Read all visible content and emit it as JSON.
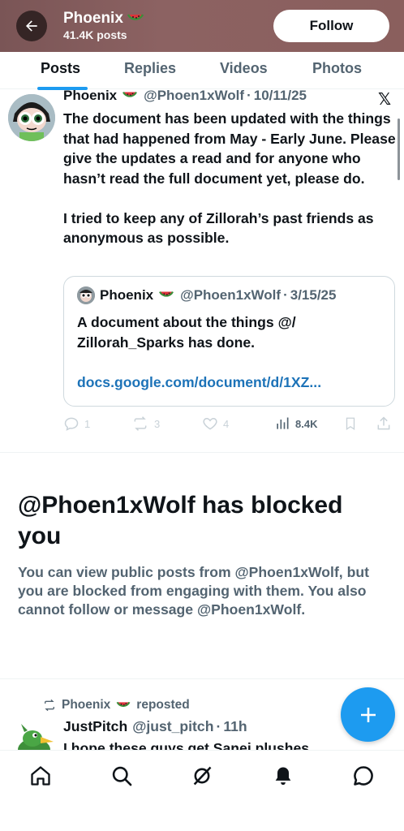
{
  "header": {
    "back_icon": "arrow-left-icon",
    "name": "Phoenix",
    "name_emoji": "watermelon-icon",
    "post_count": "41.4K posts",
    "follow_label": "Follow"
  },
  "tabs": [
    {
      "label": "Posts",
      "active": true
    },
    {
      "label": "Replies",
      "active": false
    },
    {
      "label": "Videos",
      "active": false
    },
    {
      "label": "Photos",
      "active": false
    }
  ],
  "post": {
    "name": "Phoenix",
    "handle": "@Phoen1xWolf",
    "date": "10/11/25",
    "text": "The document has been updated with the things that had happened from May - Early June. Please give the updates a read and for anyone who hasn’t read the full document yet, please do.\n\nI tried to keep any of Zillorah’s past friends as anonymous as possible.",
    "quote": {
      "name": "Phoenix",
      "handle": "@Phoen1xWolf",
      "date": "3/15/25",
      "text": "A document about the things @/ Zillorah_Sparks has done.",
      "link": "docs.google.com/document/d/1XZ..."
    },
    "actions": {
      "replies": "1",
      "reposts": "3",
      "likes": "4",
      "views": "8.4K"
    }
  },
  "blocked": {
    "title": "@Phoen1xWolf has blocked you",
    "body": "You can view public posts from @Phoen1xWolf, but you are blocked from engaging with them. You also cannot follow or message @Phoen1xWolf."
  },
  "repost": {
    "reposter": "Phoenix",
    "label": "reposted",
    "name": "JustPitch",
    "handle": "@just_pitch",
    "time": "11h",
    "text": "I hope these guys get Sanei plushes"
  },
  "fab_icon": "plus-icon",
  "nav": [
    "home-icon",
    "search-icon",
    "grok-icon",
    "notifications-icon",
    "messages-icon"
  ],
  "colors": {
    "accent": "#1d9bf0",
    "header_bg": "#8c6262",
    "link": "#1d73b8",
    "muted": "#536471"
  }
}
